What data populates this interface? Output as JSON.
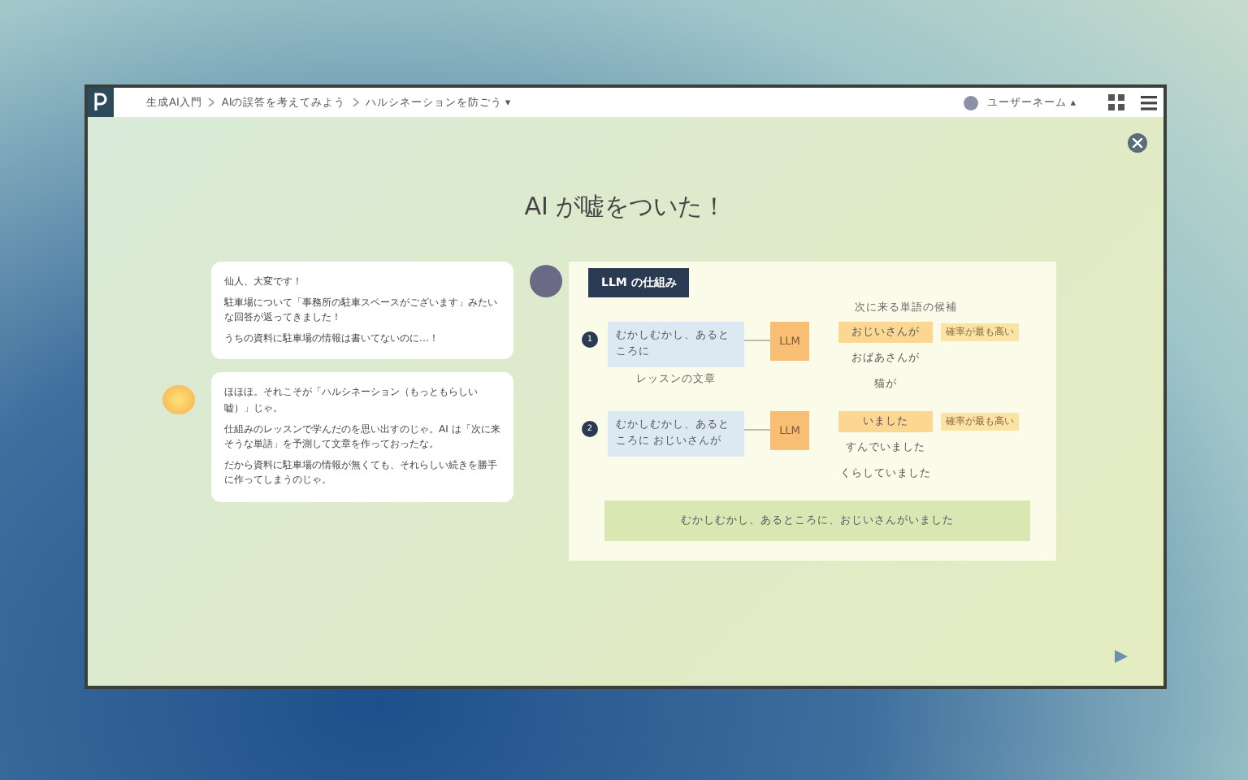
{
  "breadcrumbs": [
    {
      "label": "生成AI入門"
    },
    {
      "label": "AIの誤答を考えてみよう"
    },
    {
      "label": "ハルシネーションを防ごう ▾"
    }
  ],
  "user": {
    "name": "ユーザーネーム ▴"
  },
  "title": "AI が嘘をついた！",
  "messages": [
    {
      "kind": "user",
      "paragraphs": [
        "仙人、大変です！",
        "駐車場について「事務所の駐車スペースがございます」みたいな回答が返ってきました！",
        "うちの資料に駐車場の情報は書いてないのに…！"
      ]
    },
    {
      "kind": "sensei",
      "paragraphs": [
        "ほほほ。それこそが「ハルシネーション（もっともらしい嘘）」じゃ。",
        "仕組みのレッスンで学んだのを思い出すのじゃ。AI は「次に来そうな単語」を予測して文章を作っておったな。",
        "だから資料に駐車場の情報が無くても、それらしい続きを勝手に作ってしまうのじゃ。"
      ]
    }
  ],
  "diagram": {
    "title": "LLM の仕組み",
    "candidates_label": "次に来る単語の候補",
    "steps": [
      {
        "number": "1",
        "input": "むかしむかし、あるところに",
        "note": "レッスンの文章",
        "model": "LLM",
        "outputs": [
          {
            "text": "おじいさんが",
            "selected": true,
            "tag": "確率が最も高い"
          },
          {
            "text": "おばあさんが",
            "selected": false
          },
          {
            "text": "猫が",
            "selected": false
          }
        ]
      },
      {
        "number": "2",
        "input": "むかしむかし、あるところに おじいさんが",
        "model": "LLM",
        "outputs": [
          {
            "text": "いました",
            "selected": true,
            "tag": "確率が最も高い"
          },
          {
            "text": "すんでいました",
            "selected": false
          },
          {
            "text": "くらしていました",
            "selected": false
          }
        ]
      }
    ],
    "result": "むかしむかし、あるところに、おじいさんがいました"
  }
}
